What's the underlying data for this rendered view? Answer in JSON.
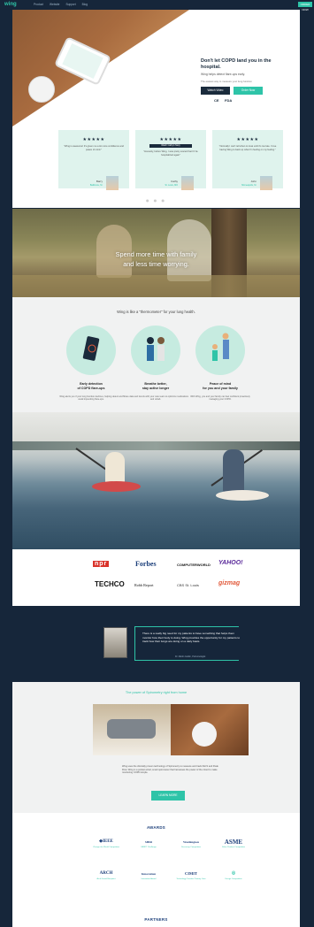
{
  "topbar": {
    "logo": "wing",
    "nav": [
      "Product",
      "Website",
      "Support",
      "Blog"
    ],
    "cta": "ORDER NOW"
  },
  "hero": {
    "title": "Don't let COPD land you in the hospital.",
    "subtitle": "Wing helps detect flare-ups early.",
    "subtitle2": "The easiest way to measure your lung function",
    "watch_video": "Watch Video",
    "order_now": "Order Now",
    "cert1": "CE",
    "cert2": "FDA"
  },
  "testimonials": [
    {
      "stars": "★★★★★",
      "label": "",
      "quote": "\"Wing is awesome! It's given me a lot more confidence and peace of mind.\"",
      "name": "Barry",
      "place": "Baltimore, M."
    },
    {
      "stars": "★★★★★",
      "label": "Watch Cathy's Story",
      "quote": "\"Honestly, before Wing, I was pretty scared that I'd be hospitalized again\"",
      "name": "Cathy",
      "place": "St. Louis, MO"
    },
    {
      "stars": "★★★★★",
      "label": "",
      "quote": "\"Normally I can't tell when to treat until it's too late. I love having Wing to back up what I'm feeling on my feeling.\"",
      "name": "John",
      "place": "Minneapolis, M."
    }
  ],
  "family": {
    "line1": "Spend more time with family",
    "line2": "and less time worrying."
  },
  "features": {
    "title": "Wing is like a \"thermometer\" for your lung health.",
    "items": [
      {
        "icon": "phone-icon",
        "head1": "Early detection",
        "head2": "of COPD flare-ups",
        "body": "Wing alerts you if your lung function declines, helping detect and avoid impending flare-ups."
      },
      {
        "icon": "couple-icon",
        "head1": "Breathe better,",
        "head2": "stay active longer",
        "body": "Share data and trends with your care team to optimize medications and rehab."
      },
      {
        "icon": "family-icon",
        "head1": "Peace of mind",
        "head2": "for you and your family",
        "body": "With Wing, you and your family can feel confident proactively managing your COPD."
      }
    ]
  },
  "press": {
    "logos": [
      "npr",
      "Forbes",
      "COMPUTERWORLD",
      "YAHOO!",
      "TECHCO",
      "Robb Report",
      "CBS St. Louis",
      "gizmag"
    ]
  },
  "quote": {
    "text": "There is a really big need for my patients to have something that helps them monitor how their body is doing. Wing provides the opportunity for my patients to track how their lungs are doing on a daily basis.",
    "signature": "Dr. Martin Goldin, Pulmonologist"
  },
  "spirometry": {
    "title": "The power of Spirometry right from home",
    "text": "Wing uses the clinically proven technology of Spirometry to measure and track FEV1 and Peak Flow. Wing is a pocket-sized, smart spirometer that harnesses the power of the cloud to make monitoring COPD simple.",
    "learn_more": "LEARN MORE"
  },
  "awards": {
    "title": "AWARDS",
    "items": [
      {
        "logo": "◆IEEE",
        "caption": "Change the World Competition"
      },
      {
        "logo": "SBIR",
        "caption": "SBIR/T Challenge"
      },
      {
        "logo": "Washington",
        "caption": "Discovery Competition"
      },
      {
        "logo": "ASME",
        "caption": "Silver Product Competition"
      },
      {
        "logo": "ARCH",
        "caption": "Arch Grand Recipient"
      },
      {
        "logo": "Innovation",
        "caption": "Innovation Award"
      },
      {
        "logo": "CIMIT",
        "caption": "Technology Transfer Primary Care"
      },
      {
        "logo": "◎",
        "caption": "Design Competition"
      }
    ]
  },
  "partners": {
    "title": "PARTNERS"
  }
}
